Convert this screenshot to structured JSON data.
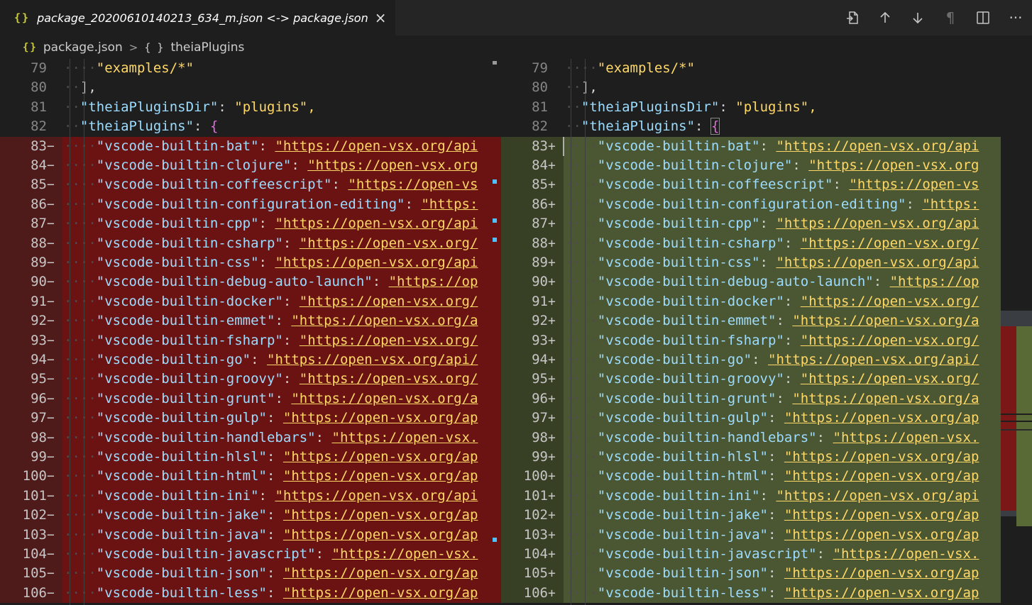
{
  "tab": {
    "icon": "{}",
    "title": "package_20200610140213_634_m.json <-> package.json",
    "close": "×"
  },
  "actions": [
    {
      "name": "open-file-icon",
      "glyph": "open-file"
    },
    {
      "name": "previous-change-icon",
      "glyph": "↑"
    },
    {
      "name": "next-change-icon",
      "glyph": "↓"
    },
    {
      "name": "whitespace-toggle-icon",
      "glyph": "¶"
    },
    {
      "name": "split-editor-icon",
      "glyph": "split"
    },
    {
      "name": "more-actions-icon",
      "glyph": "···"
    }
  ],
  "breadcrumb": {
    "file_icon": "{}",
    "file": "package.json",
    "separator": ">",
    "symbol_icon": "{ }",
    "symbol": "theiaPlugins"
  },
  "colors": {
    "deleted_line": "#6b1212",
    "inserted_line": "#4b5632",
    "string": "#ffd866",
    "key": "#9cdcfe",
    "brace": "#da70d6"
  },
  "lines": [
    {
      "n": "79",
      "kind": "ctx",
      "indent": 2,
      "key": "",
      "left_text": "\"examples/*\"",
      "right_text": "\"examples/*\""
    },
    {
      "n": "80",
      "kind": "ctx",
      "indent": 1,
      "key": "",
      "left_text": "],",
      "right_text": "],"
    },
    {
      "n": "81",
      "kind": "kv",
      "indent": 1,
      "key": "\"theiaPluginsDir\"",
      "value": "\"plugins\","
    },
    {
      "n": "82",
      "kind": "open",
      "indent": 1,
      "key": "\"theiaPlugins\""
    },
    {
      "n": "83",
      "kind": "diff",
      "key": "\"vscode-builtin-bat\"",
      "left_url": "\"https://open-vsx.org/api",
      "right_url": "\"https://open-vsx.org/api"
    },
    {
      "n": "84",
      "kind": "diff",
      "key": "\"vscode-builtin-clojure\"",
      "left_url": "\"https://open-vsx.org",
      "right_url": "\"https://open-vsx.org"
    },
    {
      "n": "85",
      "kind": "diff",
      "key": "\"vscode-builtin-coffeescript\"",
      "left_url": "\"https://open-vs",
      "right_url": "\"https://open-vs"
    },
    {
      "n": "86",
      "kind": "diff",
      "key": "\"vscode-builtin-configuration-editing\"",
      "left_url": "\"https:",
      "right_url": "\"https:"
    },
    {
      "n": "87",
      "kind": "diff",
      "key": "\"vscode-builtin-cpp\"",
      "left_url": "\"https://open-vsx.org/api",
      "right_url": "\"https://open-vsx.org/api"
    },
    {
      "n": "88",
      "kind": "diff",
      "key": "\"vscode-builtin-csharp\"",
      "left_url": "\"https://open-vsx.org/",
      "right_url": "\"https://open-vsx.org/"
    },
    {
      "n": "89",
      "kind": "diff",
      "key": "\"vscode-builtin-css\"",
      "left_url": "\"https://open-vsx.org/api",
      "right_url": "\"https://open-vsx.org/api"
    },
    {
      "n": "90",
      "kind": "diff",
      "key": "\"vscode-builtin-debug-auto-launch\"",
      "left_url": "\"https://op",
      "right_url": "\"https://op"
    },
    {
      "n": "91",
      "kind": "diff",
      "key": "\"vscode-builtin-docker\"",
      "left_url": "\"https://open-vsx.org/",
      "right_url": "\"https://open-vsx.org/"
    },
    {
      "n": "92",
      "kind": "diff",
      "key": "\"vscode-builtin-emmet\"",
      "left_url": "\"https://open-vsx.org/a",
      "right_url": "\"https://open-vsx.org/a"
    },
    {
      "n": "93",
      "kind": "diff",
      "key": "\"vscode-builtin-fsharp\"",
      "left_url": "\"https://open-vsx.org/",
      "right_url": "\"https://open-vsx.org/"
    },
    {
      "n": "94",
      "kind": "diff",
      "key": "\"vscode-builtin-go\"",
      "left_url": "\"https://open-vsx.org/api/",
      "right_url": "\"https://open-vsx.org/api/"
    },
    {
      "n": "95",
      "kind": "diff",
      "key": "\"vscode-builtin-groovy\"",
      "left_url": "\"https://open-vsx.org/",
      "right_url": "\"https://open-vsx.org/"
    },
    {
      "n": "96",
      "kind": "diff",
      "key": "\"vscode-builtin-grunt\"",
      "left_url": "\"https://open-vsx.org/a",
      "right_url": "\"https://open-vsx.org/a"
    },
    {
      "n": "97",
      "kind": "diff",
      "key": "\"vscode-builtin-gulp\"",
      "left_url": "\"https://open-vsx.org/ap",
      "right_url": "\"https://open-vsx.org/ap"
    },
    {
      "n": "98",
      "kind": "diff",
      "key": "\"vscode-builtin-handlebars\"",
      "left_url": "\"https://open-vsx.",
      "right_url": "\"https://open-vsx."
    },
    {
      "n": "99",
      "kind": "diff",
      "key": "\"vscode-builtin-hlsl\"",
      "left_url": "\"https://open-vsx.org/ap",
      "right_url": "\"https://open-vsx.org/ap"
    },
    {
      "n": "100",
      "kind": "diff",
      "key": "\"vscode-builtin-html\"",
      "left_url": "\"https://open-vsx.org/ap",
      "right_url": "\"https://open-vsx.org/ap"
    },
    {
      "n": "101",
      "kind": "diff",
      "key": "\"vscode-builtin-ini\"",
      "left_url": "\"https://open-vsx.org/api",
      "right_url": "\"https://open-vsx.org/api"
    },
    {
      "n": "102",
      "kind": "diff",
      "key": "\"vscode-builtin-jake\"",
      "left_url": "\"https://open-vsx.org/ap",
      "right_url": "\"https://open-vsx.org/ap"
    },
    {
      "n": "103",
      "kind": "diff",
      "key": "\"vscode-builtin-java\"",
      "left_url": "\"https://open-vsx.org/ap",
      "right_url": "\"https://open-vsx.org/ap"
    },
    {
      "n": "104",
      "kind": "diff",
      "key": "\"vscode-builtin-javascript\"",
      "left_url": "\"https://open-vsx.",
      "right_url": "\"https://open-vsx."
    },
    {
      "n": "105",
      "kind": "diff",
      "key": "\"vscode-builtin-json\"",
      "left_url": "\"https://open-vsx.org/ap",
      "right_url": "\"https://open-vsx.org/ap"
    },
    {
      "n": "106",
      "kind": "diff",
      "key": "\"vscode-builtin-less\"",
      "left_url": "\"https://open-vsx.org/ap",
      "right_url": "\"https://open-vsx.org/ap"
    }
  ],
  "markers": {
    "deleted": "−",
    "inserted": "+"
  }
}
